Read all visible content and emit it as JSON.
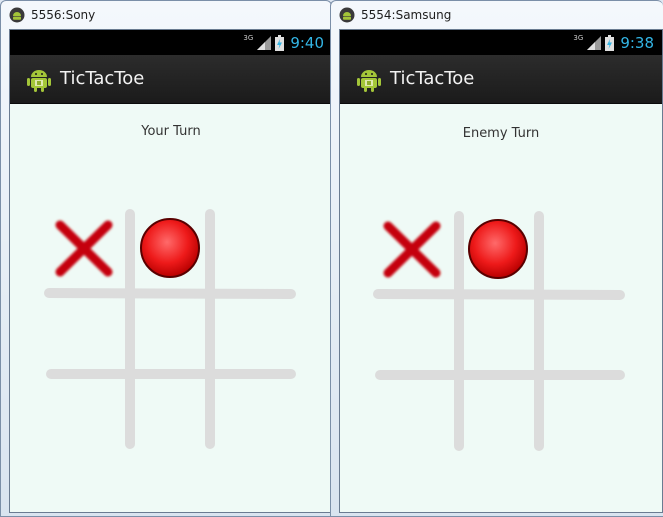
{
  "windows": [
    {
      "title": "5556:Sony",
      "network": "3G",
      "time": "9:40",
      "app_title": "TicTacToe",
      "turn_text": "Your Turn",
      "board": [
        "X",
        "O",
        "",
        "",
        "",
        "",
        "",
        "",
        ""
      ]
    },
    {
      "title": "5554:Samsung",
      "network": "3G",
      "time": "9:38",
      "app_title": "TicTacToe",
      "turn_text": "Enemy Turn",
      "board": [
        "X",
        "O",
        "",
        "",
        "",
        "",
        "",
        "",
        ""
      ]
    }
  ],
  "colors": {
    "content_bg": "#effaf6",
    "grid": "#dcdcdc",
    "x_mark": "#c5000b",
    "o_mark": "#ee1a1a",
    "clock": "#33b5e5"
  },
  "icons": {
    "window": "android-emulator-icon",
    "app": "android-robot-icon",
    "signal": "signal-bars-icon",
    "battery": "charging-battery-icon"
  }
}
